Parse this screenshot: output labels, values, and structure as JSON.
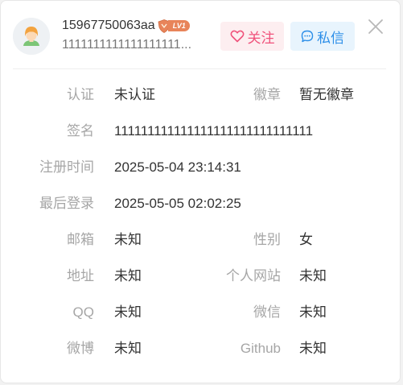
{
  "header": {
    "username": "15967750063aa",
    "level": "LV1",
    "bio": "1111111111111111111...",
    "follow_label": "关注",
    "message_label": "私信"
  },
  "fields": {
    "auth_label": "认证",
    "auth_value": "未认证",
    "badge_label": "徽章",
    "badge_value": "暂无徽章",
    "signature_label": "签名",
    "signature_value": "111111111111111111111111111111",
    "register_label": "注册时间",
    "register_value": "2025-05-04 23:14:31",
    "last_login_label": "最后登录",
    "last_login_value": "2025-05-05 02:02:25",
    "email_label": "邮箱",
    "email_value": "未知",
    "gender_label": "性别",
    "gender_value": "女",
    "address_label": "地址",
    "address_value": "未知",
    "website_label": "个人网站",
    "website_value": "未知",
    "qq_label": "QQ",
    "qq_value": "未知",
    "wechat_label": "微信",
    "wechat_value": "未知",
    "weibo_label": "微博",
    "weibo_value": "未知",
    "github_label": "Github",
    "github_value": "未知"
  },
  "colors": {
    "follow_accent": "#f0527b",
    "message_accent": "#2b8ee8",
    "level_badge": "#e8845a",
    "label_gray": "#a6a6a6"
  },
  "icons": {
    "avatar": "user-avatar",
    "level": "level-shield-icon",
    "follow": "heart-icon",
    "message": "chat-bubble-icon",
    "close": "close-icon"
  }
}
